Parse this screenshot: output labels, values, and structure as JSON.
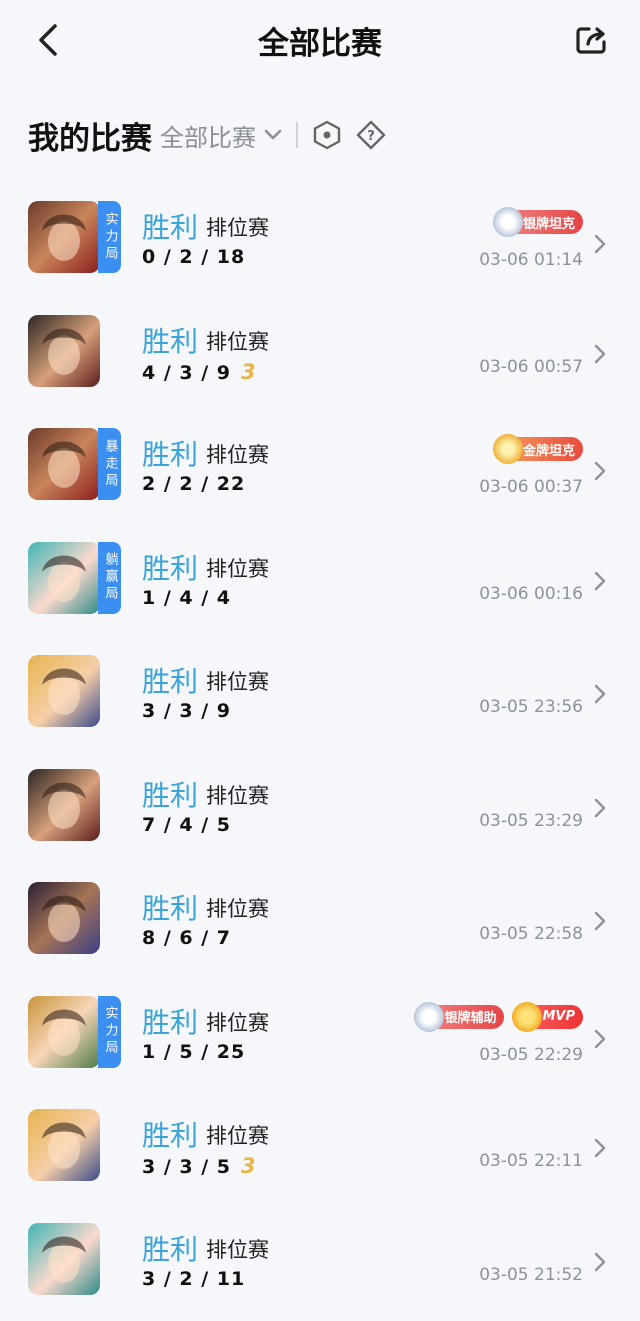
{
  "header": {
    "title": "全部比赛"
  },
  "filter": {
    "section_title": "我的比赛",
    "selected": "全部比赛"
  },
  "matches": [
    {
      "result": "胜利",
      "type": "排位赛",
      "kda": "0 / 2 / 18",
      "time": "03-06 01:14",
      "mode_tag": "实力局",
      "badges": [
        "银牌坦克"
      ],
      "avatar": "hero-a"
    },
    {
      "result": "胜利",
      "type": "排位赛",
      "kda": "4 / 3 / 9",
      "triple": "3",
      "time": "03-06 00:57",
      "mode_tag": "",
      "badges": [],
      "avatar": "hero-b"
    },
    {
      "result": "胜利",
      "type": "排位赛",
      "kda": "2 / 2 / 22",
      "time": "03-06 00:37",
      "mode_tag": "暴走局",
      "badges": [
        "金牌坦克"
      ],
      "avatar": "hero-a"
    },
    {
      "result": "胜利",
      "type": "排位赛",
      "kda": "1 / 4 / 4",
      "time": "03-06 00:16",
      "mode_tag": "躺赢局",
      "badges": [],
      "avatar": "hero-c"
    },
    {
      "result": "胜利",
      "type": "排位赛",
      "kda": "3 / 3 / 9",
      "time": "03-05 23:56",
      "mode_tag": "",
      "badges": [],
      "avatar": "hero-d"
    },
    {
      "result": "胜利",
      "type": "排位赛",
      "kda": "7 / 4 / 5",
      "time": "03-05 23:29",
      "mode_tag": "",
      "badges": [],
      "avatar": "hero-b"
    },
    {
      "result": "胜利",
      "type": "排位赛",
      "kda": "8 / 6 / 7",
      "time": "03-05 22:58",
      "mode_tag": "",
      "badges": [],
      "avatar": "hero-e"
    },
    {
      "result": "胜利",
      "type": "排位赛",
      "kda": "1 / 5 / 25",
      "time": "03-05 22:29",
      "mode_tag": "实力局",
      "badges": [
        "银牌辅助",
        "MVP"
      ],
      "avatar": "hero-f"
    },
    {
      "result": "胜利",
      "type": "排位赛",
      "kda": "3 / 3 / 5",
      "triple": "3",
      "time": "03-05 22:11",
      "mode_tag": "",
      "badges": [],
      "avatar": "hero-d"
    },
    {
      "result": "胜利",
      "type": "排位赛",
      "kda": "3 / 2 / 11",
      "time": "03-05 21:52",
      "mode_tag": "",
      "badges": [],
      "avatar": "hero-c"
    }
  ],
  "colors": {
    "accent": "#3aa3d8",
    "tag": "#3b8ff0",
    "triple": "#e9b64a"
  },
  "icons": {
    "back": "back-arrow-icon",
    "share": "share-icon",
    "hexagon": "hexagon-filter-icon",
    "help": "diamond-help-icon"
  }
}
